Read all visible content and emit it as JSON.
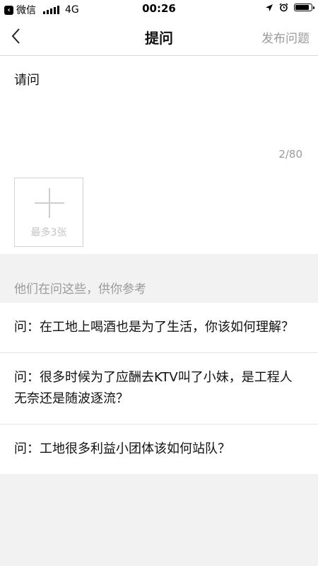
{
  "status_bar": {
    "app_back": "微信",
    "network": "4G",
    "time": "00:26"
  },
  "nav": {
    "title": "提问",
    "action": "发布问题"
  },
  "compose": {
    "text": "请问",
    "counter": "2/80",
    "add_image_label": "最多3张"
  },
  "suggestions": {
    "header": "他们在问这些，供你参考",
    "prefix": "问：",
    "items": [
      {
        "text": "在工地上喝酒也是为了生活，你该如何理解？"
      },
      {
        "text": "很多时候为了应酬去KTV叫了小妹，是工程人无奈还是随波逐流？"
      },
      {
        "text": "工地很多利益小团体该如何站队？"
      }
    ]
  }
}
